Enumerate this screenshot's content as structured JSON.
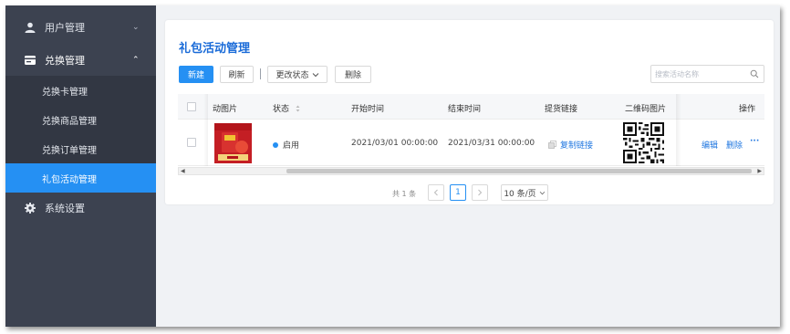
{
  "sidebar": {
    "menus": [
      {
        "label": "用户管理",
        "arrow": "⌄",
        "icon": "user-icon"
      },
      {
        "label": "兑换管理",
        "arrow": "⌃",
        "icon": "card-icon"
      },
      {
        "label": "系统设置",
        "icon": "gear-icon"
      }
    ],
    "submenu": [
      {
        "label": "兑换卡管理"
      },
      {
        "label": "兑换商品管理"
      },
      {
        "label": "兑换订单管理"
      },
      {
        "label": "礼包活动管理",
        "active": true
      }
    ]
  },
  "main": {
    "title": "礼包活动管理",
    "toolbar": {
      "new_label": "新建",
      "refresh_label": "刷新",
      "change_status_label": "更改状态",
      "delete_label": "删除"
    },
    "search": {
      "placeholder": "搜索活动名称",
      "value": ""
    },
    "table": {
      "columns": {
        "image": "动图片",
        "status": "状态",
        "start": "开始时间",
        "end": "结束时间",
        "link": "提货链接",
        "qr": "二维码图片",
        "actions": "操作"
      },
      "rows": [
        {
          "status": "启用",
          "start_time": "2021/03/01 00:00:00",
          "end_time": "2021/03/31 00:00:00",
          "copy_link": "复制链接",
          "edit": "编辑",
          "delete": "删除",
          "more": "···"
        }
      ]
    },
    "pagination": {
      "total": "共 1 条",
      "current_page": "1",
      "page_size": "10 条/页"
    }
  },
  "colors": {
    "accent": "#2590f3",
    "sidebar_bg": "#3c4250",
    "status_enabled": "#2590f3"
  }
}
